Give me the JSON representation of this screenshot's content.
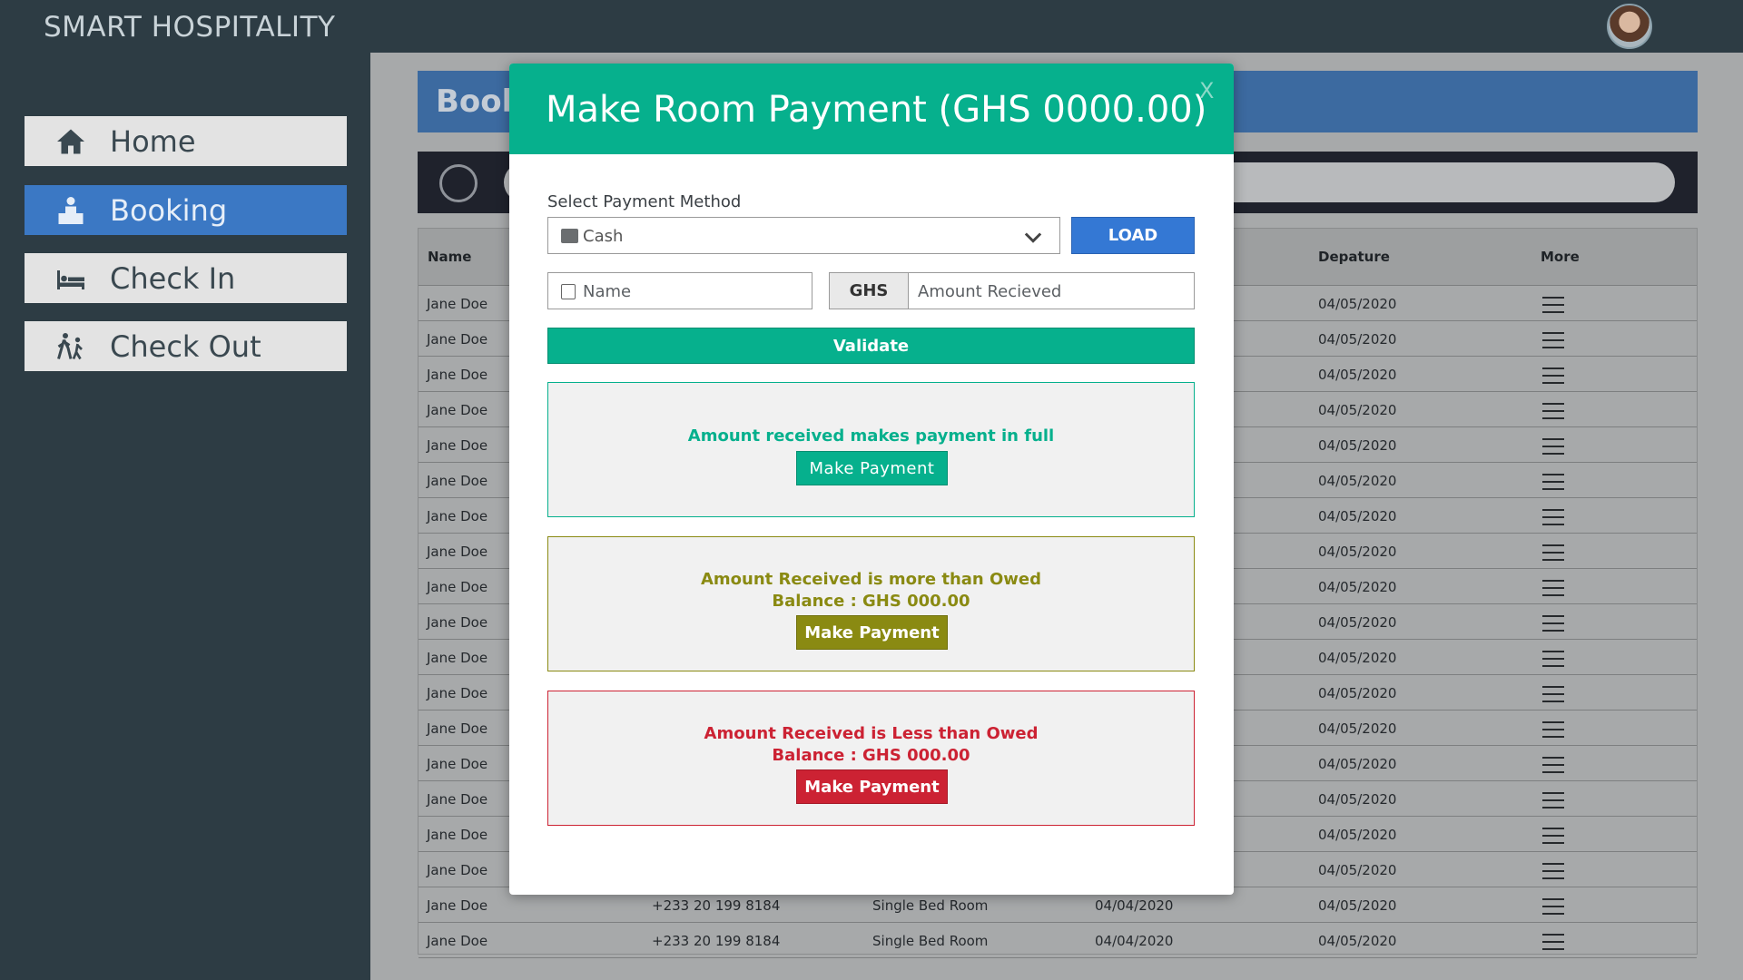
{
  "app": {
    "title": "SMART HOSPITALITY"
  },
  "sidebar": {
    "items": [
      {
        "label": "Home",
        "icon": "home-icon"
      },
      {
        "label": "Booking",
        "icon": "reception-desk-icon",
        "active": true
      },
      {
        "label": "Check In",
        "icon": "bed-icon"
      },
      {
        "label": "Check Out",
        "icon": "walking-person-icon"
      }
    ]
  },
  "page": {
    "header_visible": "Book"
  },
  "table": {
    "headers": {
      "name": "Name",
      "departure": "Depature",
      "more": "More"
    },
    "rows": [
      {
        "name": "Jane Doe",
        "phone": "",
        "room": "",
        "arrival": "",
        "departure": "04/05/2020"
      },
      {
        "name": "Jane Doe",
        "phone": "",
        "room": "",
        "arrival": "",
        "departure": "04/05/2020"
      },
      {
        "name": "Jane Doe",
        "phone": "",
        "room": "",
        "arrival": "",
        "departure": "04/05/2020"
      },
      {
        "name": "Jane Doe",
        "phone": "",
        "room": "",
        "arrival": "",
        "departure": "04/05/2020"
      },
      {
        "name": "Jane Doe",
        "phone": "",
        "room": "",
        "arrival": "",
        "departure": "04/05/2020"
      },
      {
        "name": "Jane Doe",
        "phone": "",
        "room": "",
        "arrival": "",
        "departure": "04/05/2020"
      },
      {
        "name": "Jane Doe",
        "phone": "",
        "room": "",
        "arrival": "",
        "departure": "04/05/2020"
      },
      {
        "name": "Jane Doe",
        "phone": "",
        "room": "",
        "arrival": "",
        "departure": "04/05/2020"
      },
      {
        "name": "Jane Doe",
        "phone": "",
        "room": "",
        "arrival": "",
        "departure": "04/05/2020"
      },
      {
        "name": "Jane Doe",
        "phone": "",
        "room": "",
        "arrival": "",
        "departure": "04/05/2020"
      },
      {
        "name": "Jane Doe",
        "phone": "",
        "room": "",
        "arrival": "",
        "departure": "04/05/2020"
      },
      {
        "name": "Jane Doe",
        "phone": "",
        "room": "",
        "arrival": "",
        "departure": "04/05/2020"
      },
      {
        "name": "Jane Doe",
        "phone": "",
        "room": "",
        "arrival": "",
        "departure": "04/05/2020"
      },
      {
        "name": "Jane Doe",
        "phone": "",
        "room": "",
        "arrival": "",
        "departure": "04/05/2020"
      },
      {
        "name": "Jane Doe",
        "phone": "",
        "room": "",
        "arrival": "",
        "departure": "04/05/2020"
      },
      {
        "name": "Jane Doe",
        "phone": "",
        "room": "",
        "arrival": "",
        "departure": "04/05/2020"
      },
      {
        "name": "Jane Doe",
        "phone": "",
        "room": "",
        "arrival": "",
        "departure": "04/05/2020"
      },
      {
        "name": "Jane Doe",
        "phone": "+233 20 199 8184",
        "room": "Single Bed Room",
        "arrival": "04/04/2020",
        "departure": "04/05/2020"
      },
      {
        "name": "Jane Doe",
        "phone": "+233 20 199 8184",
        "room": "Single Bed Room",
        "arrival": "04/04/2020",
        "departure": "04/05/2020"
      }
    ]
  },
  "modal": {
    "title": "Make Room Payment (GHS 0000.00)",
    "close_label": "X",
    "method_label": "Select Payment Method",
    "method_value": "Cash",
    "load_label": "LOAD",
    "name_placeholder": "Name",
    "currency_prefix": "GHS",
    "amount_placeholder": "Amount Recieved",
    "validate_label": "Validate",
    "full": {
      "message": "Amount received makes payment in full",
      "button": "Make Payment"
    },
    "more": {
      "message": "Amount Received is more than Owed",
      "balance": "Balance : GHS 000.00",
      "button": "Make Payment"
    },
    "less": {
      "message": "Amount Received is Less than Owed",
      "balance": "Balance : GHS 000.00",
      "button": "Make Payment"
    }
  },
  "colors": {
    "accent_green": "#06b08d",
    "active_nav": "#3b78c4",
    "warning_olive": "#8a8a12",
    "danger_red": "#cc2233",
    "sidebar_bg": "#2d3c44"
  }
}
